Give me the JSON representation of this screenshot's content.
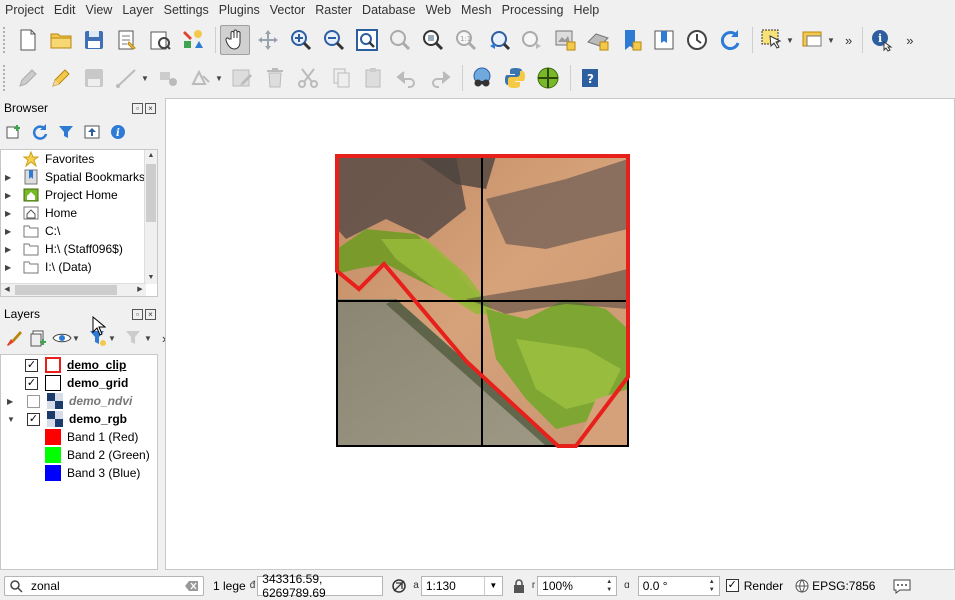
{
  "menu": [
    "Project",
    "Edit",
    "View",
    "Layer",
    "Settings",
    "Plugins",
    "Vector",
    "Raster",
    "Database",
    "Web",
    "Mesh",
    "Processing",
    "Help"
  ],
  "browser": {
    "title": "Browser",
    "items": [
      {
        "label": "Favorites",
        "icon": "star-icon"
      },
      {
        "label": "Spatial Bookmarks",
        "icon": "bookmark-icon"
      },
      {
        "label": "Project Home",
        "icon": "project-home-icon"
      },
      {
        "label": "Home",
        "icon": "home-icon"
      },
      {
        "label": "C:\\",
        "icon": "folder-icon"
      },
      {
        "label": "H:\\ (Staff096$)",
        "icon": "folder-icon"
      },
      {
        "label": "I:\\ (Data)",
        "icon": "folder-icon"
      }
    ]
  },
  "layers": {
    "title": "Layers",
    "items": [
      {
        "name": "demo_clip",
        "checked": true
      },
      {
        "name": "demo_grid",
        "checked": true
      },
      {
        "name": "demo_ndvi",
        "checked": false
      },
      {
        "name": "demo_rgb",
        "checked": true
      }
    ],
    "bands": [
      {
        "label": "Band 1 (Red)",
        "color": "#ff0000"
      },
      {
        "label": "Band 2 (Green)",
        "color": "#00ff00"
      },
      {
        "label": "Band 3 (Blue)",
        "color": "#0000ff"
      }
    ]
  },
  "status": {
    "search_value": "zonal",
    "legend_text": "1 lege",
    "coord_label_prefix": "đ",
    "coordinates": "343316.59, 6269789.69",
    "scale_prefix": "a",
    "scale": "1:130",
    "magnifier_prefix": "r",
    "magnifier": "100%",
    "rotation_prefix": "ɑ",
    "rotation": "0.0 °",
    "render_label": "Render",
    "render_checked": true,
    "crs": "EPSG:7856"
  },
  "colors": {
    "clip_outline": "#e8201c",
    "grid_line": "#000000",
    "accent": "#2d7bd4"
  }
}
